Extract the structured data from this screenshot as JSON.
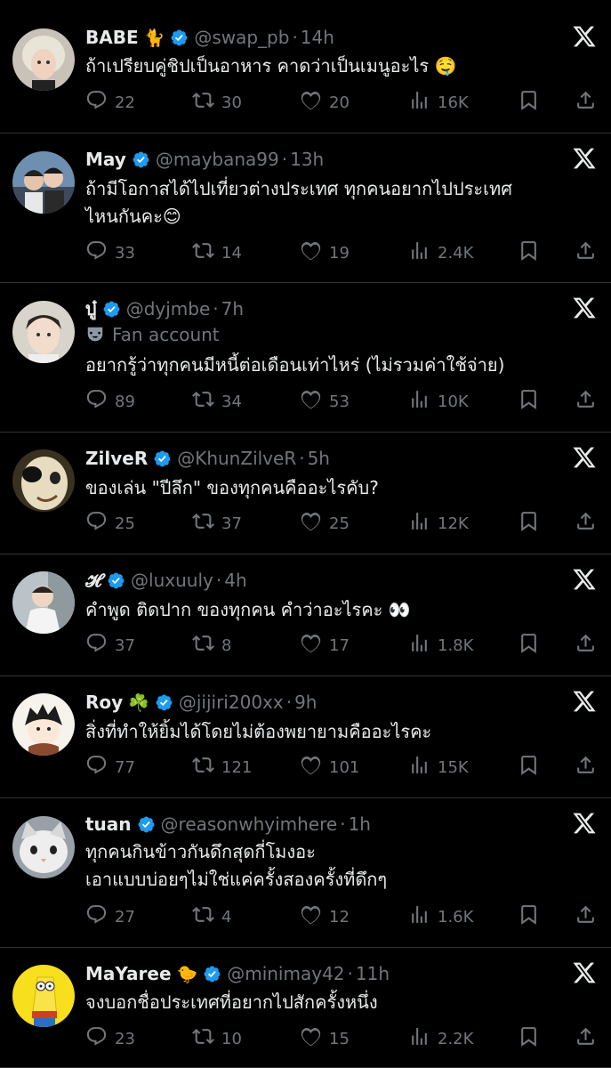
{
  "posts": [
    {
      "name": "BABE",
      "name_emoji": "🐈",
      "handle": "@swap_pb",
      "time": "14h",
      "fan_account": "",
      "text": [
        "ถ้าเปรียบคู่ชิปเป็นอาหาร คาดว่าเป็นเมนูอะไร 🤤"
      ],
      "replies": "22",
      "reposts": "30",
      "likes": "20",
      "views": "16K"
    },
    {
      "name": "May",
      "name_emoji": "",
      "handle": "@maybana99",
      "time": "13h",
      "fan_account": "",
      "text": [
        "ถ้ามีโอกาสได้ไปเที่ยวต่างประเทศ ทุกคนอยากไปประเทศ",
        "ไหนกันคะ😊"
      ],
      "replies": "33",
      "reposts": "14",
      "likes": "19",
      "views": "2.4K"
    },
    {
      "name": "บู๋",
      "name_emoji": "",
      "handle": "@dyjmbe",
      "time": "7h",
      "fan_account": "Fan account",
      "text": [
        "อยากรู้ว่าทุกคนมีหนี้ต่อเดือนเท่าไหร่ (ไม่รวมค่าใช้จ่าย)"
      ],
      "replies": "89",
      "reposts": "34",
      "likes": "53",
      "views": "10K"
    },
    {
      "name": "ZilveR",
      "name_emoji": "",
      "handle": "@KhunZilveR",
      "time": "5h",
      "fan_account": "",
      "text": [
        "ของเล่น \"ปีลึก\" ของทุกคนคืออะไรคับ?"
      ],
      "replies": "25",
      "reposts": "37",
      "likes": "25",
      "views": "12K"
    },
    {
      "name": "𝓗",
      "name_emoji": "",
      "handle": "@luxuuly",
      "time": "4h",
      "fan_account": "",
      "text": [
        "คำพูด ติดปาก ของทุกคน คำว่าอะไรคะ 👀"
      ],
      "replies": "37",
      "reposts": "8",
      "likes": "17",
      "views": "1.8K"
    },
    {
      "name": "Roy",
      "name_emoji": "☘️",
      "handle": "@jijiri200xx",
      "time": "9h",
      "fan_account": "",
      "text": [
        "สิ่งที่ทำให้ยิ้มได้โดยไม่ต้องพยายามคืออะไรคะ"
      ],
      "replies": "77",
      "reposts": "121",
      "likes": "101",
      "views": "15K"
    },
    {
      "name": "tuan",
      "name_emoji": "",
      "handle": "@reasonwhyimhere",
      "time": "1h",
      "fan_account": "",
      "text": [
        "ทุกคนกินข้าวกันดึกสุดกี่โมงอะ",
        "เอาแบบบ่อยๆไม่ใช่แค่ครั้งสองครั้งที่ดึกๆ"
      ],
      "replies": "27",
      "reposts": "4",
      "likes": "12",
      "views": "1.6K"
    },
    {
      "name": "MaYaree",
      "name_emoji": "🐤",
      "handle": "@minimay42",
      "time": "11h",
      "fan_account": "",
      "text": [
        "จงบอกชื่อประเทศที่อยากไปสักครั้งหนึ่ง"
      ],
      "replies": "23",
      "reposts": "10",
      "likes": "15",
      "views": "2.2K"
    }
  ],
  "separator": "·",
  "colors": {
    "background": "#000000",
    "text": "#e7e9ea",
    "muted": "#71767b",
    "verified": "#1d9bf0",
    "divider": "#2f3336"
  }
}
